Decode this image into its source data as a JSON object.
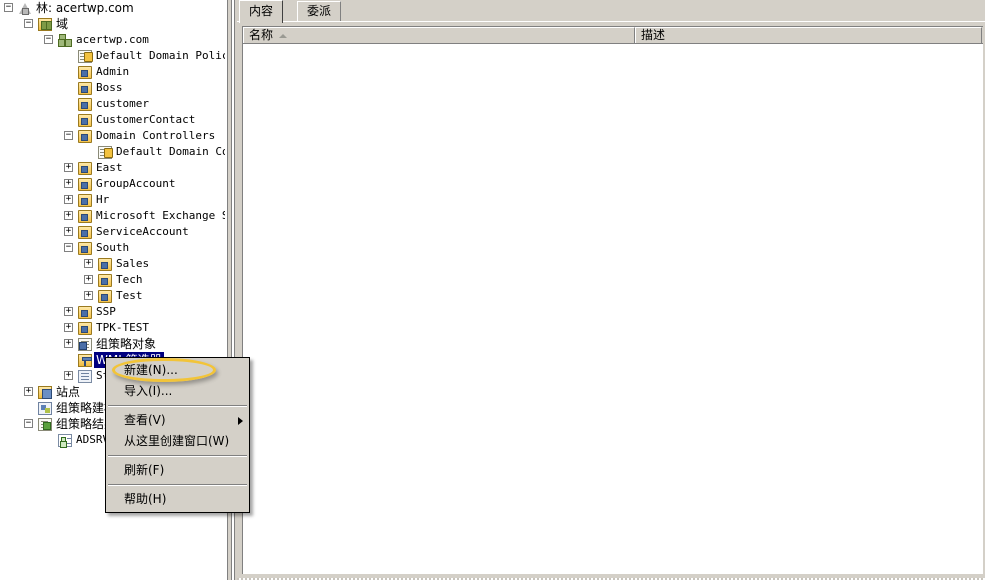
{
  "tree": {
    "items": [
      {
        "label": "林: acertwp.com",
        "icon": "forest-icon",
        "indent": 0,
        "expander": "minus",
        "cjk": true,
        "selected": false
      },
      {
        "label": "域",
        "icon": "domains-icon",
        "indent": 1,
        "expander": "minus",
        "cjk": true,
        "selected": false
      },
      {
        "label": "acertwp.com",
        "icon": "domain-icon",
        "indent": 2,
        "expander": "minus",
        "cjk": false,
        "selected": false
      },
      {
        "label": "Default Domain Policy",
        "icon": "gpo-link-icon",
        "indent": 3,
        "expander": "none",
        "cjk": false,
        "selected": false
      },
      {
        "label": "Admin",
        "icon": "folder-icon",
        "indent": 3,
        "expander": "none",
        "cjk": false,
        "selected": false
      },
      {
        "label": "Boss",
        "icon": "folder-icon",
        "indent": 3,
        "expander": "none",
        "cjk": false,
        "selected": false
      },
      {
        "label": "customer",
        "icon": "folder-icon",
        "indent": 3,
        "expander": "none",
        "cjk": false,
        "selected": false
      },
      {
        "label": "CustomerContact",
        "icon": "folder-icon",
        "indent": 3,
        "expander": "none",
        "cjk": false,
        "selected": false
      },
      {
        "label": "Domain Controllers",
        "icon": "folder-icon",
        "indent": 3,
        "expander": "minus",
        "cjk": false,
        "selected": false
      },
      {
        "label": "Default Domain Cont",
        "icon": "gpo-link-icon",
        "indent": 4,
        "expander": "none",
        "cjk": false,
        "selected": false
      },
      {
        "label": "East",
        "icon": "folder-icon",
        "indent": 3,
        "expander": "plus",
        "cjk": false,
        "selected": false
      },
      {
        "label": "GroupAccount",
        "icon": "folder-icon",
        "indent": 3,
        "expander": "plus",
        "cjk": false,
        "selected": false
      },
      {
        "label": "Hr",
        "icon": "folder-icon",
        "indent": 3,
        "expander": "plus",
        "cjk": false,
        "selected": false
      },
      {
        "label": "Microsoft Exchange Sec",
        "icon": "folder-icon",
        "indent": 3,
        "expander": "plus",
        "cjk": false,
        "selected": false
      },
      {
        "label": "ServiceAccount",
        "icon": "folder-icon",
        "indent": 3,
        "expander": "plus",
        "cjk": false,
        "selected": false
      },
      {
        "label": "South",
        "icon": "folder-icon",
        "indent": 3,
        "expander": "minus",
        "cjk": false,
        "selected": false
      },
      {
        "label": "Sales",
        "icon": "folder-icon",
        "indent": 4,
        "expander": "plus",
        "cjk": false,
        "selected": false
      },
      {
        "label": "Tech",
        "icon": "folder-icon",
        "indent": 4,
        "expander": "plus",
        "cjk": false,
        "selected": false
      },
      {
        "label": "Test",
        "icon": "folder-icon",
        "indent": 4,
        "expander": "plus",
        "cjk": false,
        "selected": false
      },
      {
        "label": "SSP",
        "icon": "folder-icon",
        "indent": 3,
        "expander": "plus",
        "cjk": false,
        "selected": false
      },
      {
        "label": "TPK-TEST",
        "icon": "folder-icon",
        "indent": 3,
        "expander": "plus",
        "cjk": false,
        "selected": false
      },
      {
        "label": "组策略对象",
        "icon": "gpo-icon",
        "indent": 3,
        "expander": "plus",
        "cjk": true,
        "selected": false
      },
      {
        "label": "WMI 筛选器",
        "icon": "wmi-icon",
        "indent": 3,
        "expander": "none",
        "cjk": true,
        "selected": true
      },
      {
        "label": "St",
        "icon": "starter-icon",
        "indent": 3,
        "expander": "plus",
        "cjk": false,
        "selected": false
      },
      {
        "label": "站点",
        "icon": "sites-icon",
        "indent": 1,
        "expander": "plus",
        "cjk": true,
        "selected": false
      },
      {
        "label": "组策略建模",
        "icon": "modeling-icon",
        "indent": 1,
        "expander": "none",
        "cjk": true,
        "selected": false
      },
      {
        "label": "组策略结果",
        "icon": "results-icon",
        "indent": 1,
        "expander": "minus",
        "cjk": true,
        "selected": false
      },
      {
        "label": "ADSRV",
        "icon": "report-icon",
        "indent": 2,
        "expander": "none",
        "cjk": false,
        "selected": false
      }
    ]
  },
  "result_pane": {
    "tabs": [
      {
        "label": "内容",
        "active": true
      },
      {
        "label": "委派",
        "active": false
      }
    ],
    "columns": [
      {
        "label": "名称",
        "sorted": true
      },
      {
        "label": "描述",
        "sorted": false
      }
    ],
    "rows": []
  },
  "context_menu": {
    "items": [
      {
        "label": "新建(N)...",
        "type": "item",
        "submenu": false,
        "highlighted": true
      },
      {
        "label": "导入(I)...",
        "type": "item",
        "submenu": false,
        "highlighted": false
      },
      {
        "label": "",
        "type": "separator",
        "submenu": false,
        "highlighted": false
      },
      {
        "label": "查看(V)",
        "type": "item",
        "submenu": true,
        "highlighted": false
      },
      {
        "label": "从这里创建窗口(W)",
        "type": "item",
        "submenu": false,
        "highlighted": false
      },
      {
        "label": "",
        "type": "separator",
        "submenu": false,
        "highlighted": false
      },
      {
        "label": "刷新(F)",
        "type": "item",
        "submenu": false,
        "highlighted": false
      },
      {
        "label": "",
        "type": "separator",
        "submenu": false,
        "highlighted": false
      },
      {
        "label": "帮助(H)",
        "type": "item",
        "submenu": false,
        "highlighted": false
      }
    ]
  },
  "annotation": {
    "shape": "ellipse",
    "color": "#f2c438",
    "target_label": "新建(N)..."
  },
  "colors": {
    "selection": "#000080",
    "chrome": "#d4d0c8",
    "annotation": "#f2c438",
    "text": "#000000"
  }
}
